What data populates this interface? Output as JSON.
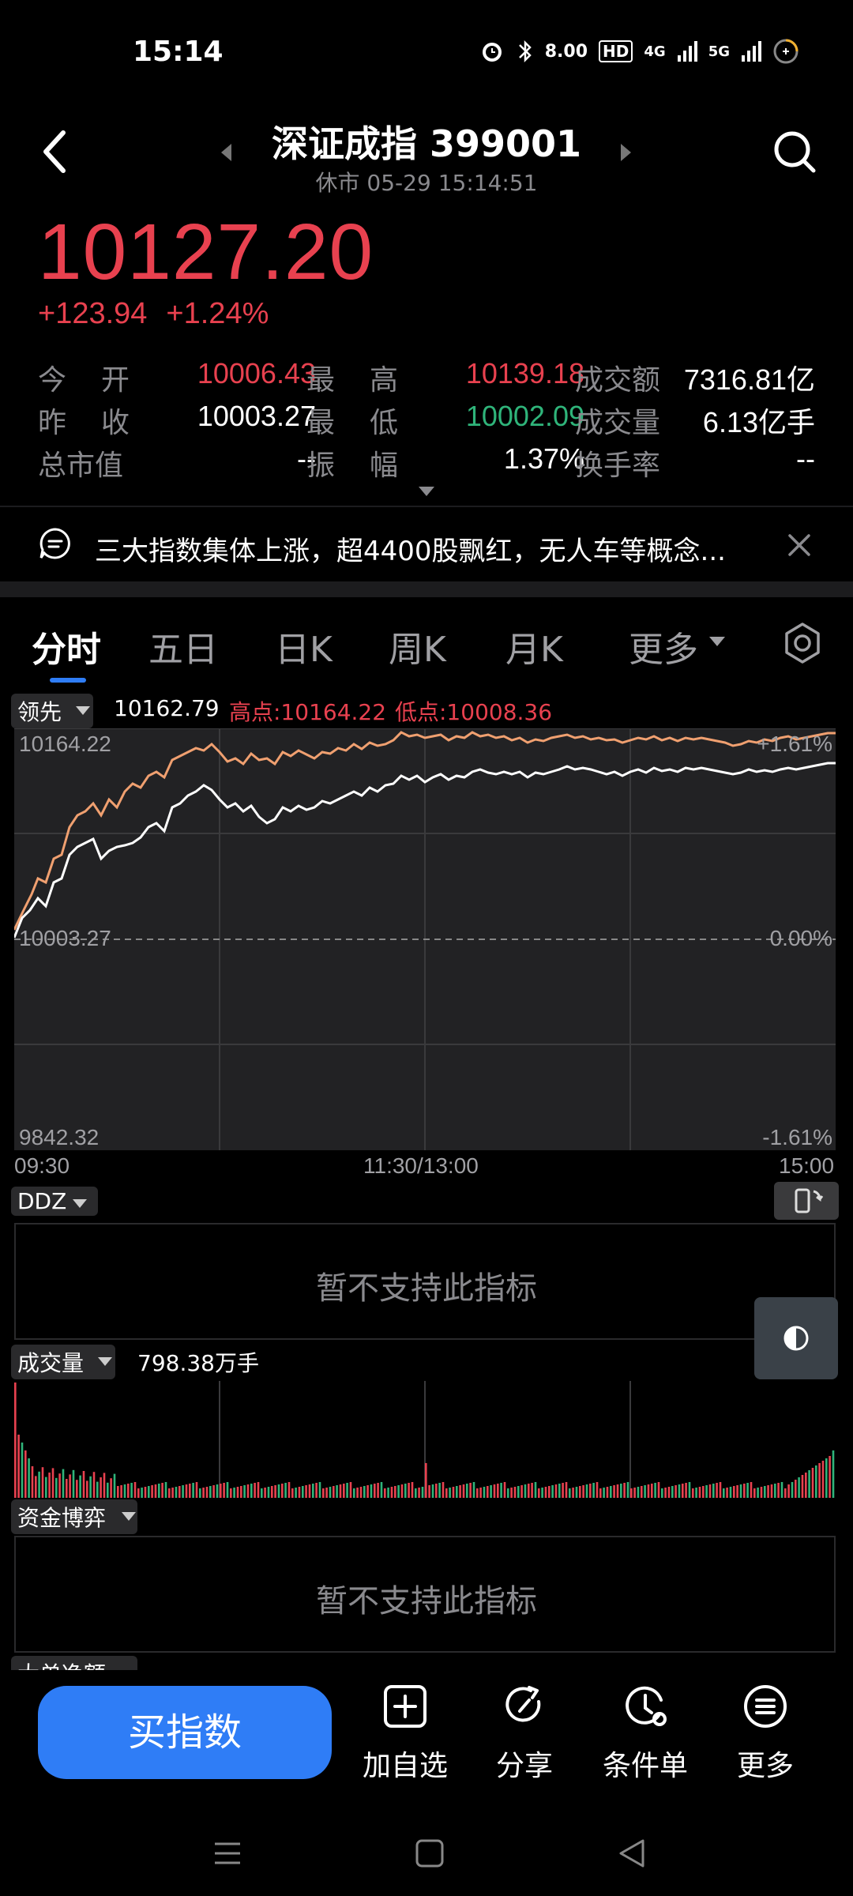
{
  "status_bar": {
    "time": "15:14",
    "speed": "8.00",
    "hd": "HD",
    "net1": "4G",
    "net2": "5G"
  },
  "header": {
    "title": "深证成指 399001",
    "subtitle": "休市 05-29 15:14:51"
  },
  "quote": {
    "price": "10127.20",
    "change": "+123.94",
    "change_pct": "+1.24%",
    "rows": [
      {
        "l1": "今",
        "l1b": "开",
        "v1": "10006.43",
        "c1": "red",
        "l2": "最",
        "l2b": "高",
        "v2": "10139.18",
        "c2": "red",
        "l3": "成交额",
        "v3": "7316.81亿"
      },
      {
        "l1": "昨",
        "l1b": "收",
        "v1": "10003.27",
        "c1": "white",
        "l2": "最",
        "l2b": "低",
        "v2": "10002.09",
        "c2": "green",
        "l3": "成交量",
        "v3": "6.13亿手"
      },
      {
        "l1": "总市值",
        "l1b": "",
        "v1": "--",
        "c1": "white",
        "l2": "振",
        "l2b": "幅",
        "v2": "1.37%",
        "c2": "white",
        "l3": "换手率",
        "v3": "--"
      }
    ]
  },
  "news": {
    "text": "三大指数集体上涨，超4400股飘红，无人车等概念..."
  },
  "tabs": [
    "分时",
    "五日",
    "日K",
    "周K",
    "月K",
    "更多"
  ],
  "intraday": {
    "lead_label": "领先",
    "current": "10162.79",
    "high_label": "高点:10164.22",
    "low_label": "低点:10008.36",
    "y_top": "10164.22",
    "y_mid": "10003.27",
    "y_bottom": "9842.32",
    "pct_top": "+1.61%",
    "pct_mid": "0.00%",
    "pct_bottom": "-1.61%",
    "time_start": "09:30",
    "time_mid": "11:30/13:00",
    "time_end": "15:00"
  },
  "ddz": {
    "label": "DDZ",
    "message": "暂不支持此指标"
  },
  "volume": {
    "label": "成交量",
    "value": "798.38万手"
  },
  "capital": {
    "label": "资金博弈",
    "message": "暂不支持此指标"
  },
  "next_indicator": {
    "label": "大单净额"
  },
  "bottom": {
    "buy": "买指数",
    "actions": [
      "加自选",
      "分享",
      "条件单",
      "更多"
    ]
  },
  "colors": {
    "up": "#e8414f",
    "down": "#2fb47a",
    "accent": "#2f7df6",
    "lead_line": "#f0a070"
  }
}
